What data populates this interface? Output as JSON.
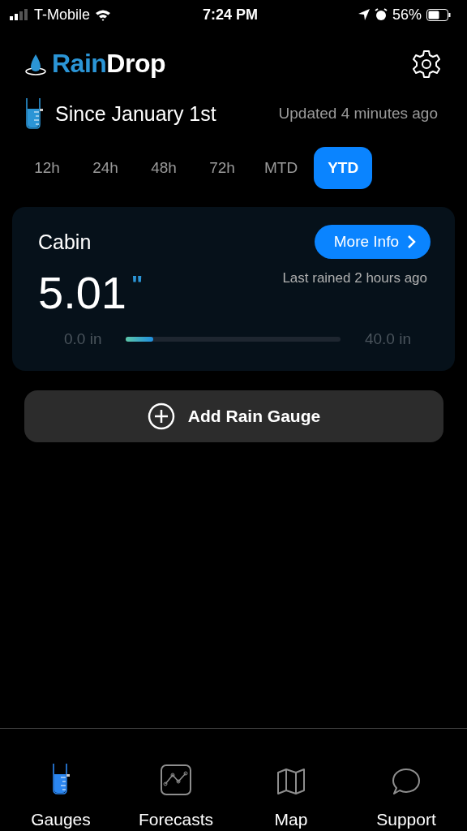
{
  "status_bar": {
    "carrier": "T-Mobile",
    "time": "7:24 PM",
    "battery": "56%"
  },
  "logo": {
    "parts": [
      "Rain",
      "Drop"
    ]
  },
  "period": {
    "title": "Since January 1st",
    "updated": "Updated 4 minutes ago"
  },
  "ranges": [
    {
      "label": "12h",
      "selected": false
    },
    {
      "label": "24h",
      "selected": false
    },
    {
      "label": "48h",
      "selected": false
    },
    {
      "label": "72h",
      "selected": false
    },
    {
      "label": "MTD",
      "selected": false
    },
    {
      "label": "YTD",
      "selected": true
    }
  ],
  "gauges": [
    {
      "name": "Cabin",
      "button": "More Info",
      "last_rained": "Last rained 2 hours ago",
      "amount": "5.01",
      "unit": "\"",
      "min": "0.0 in",
      "max": "40.0 in",
      "level": 0.125
    }
  ],
  "add_button": "Add Rain Gauge",
  "tab_bar": [
    {
      "label": "Gauges",
      "kind": "gauge",
      "selected": true
    },
    {
      "label": "Forecasts",
      "kind": "chart",
      "selected": false
    },
    {
      "label": "Map",
      "kind": "map",
      "selected": false
    },
    {
      "label": "Support",
      "kind": "chat",
      "selected": false
    }
  ]
}
